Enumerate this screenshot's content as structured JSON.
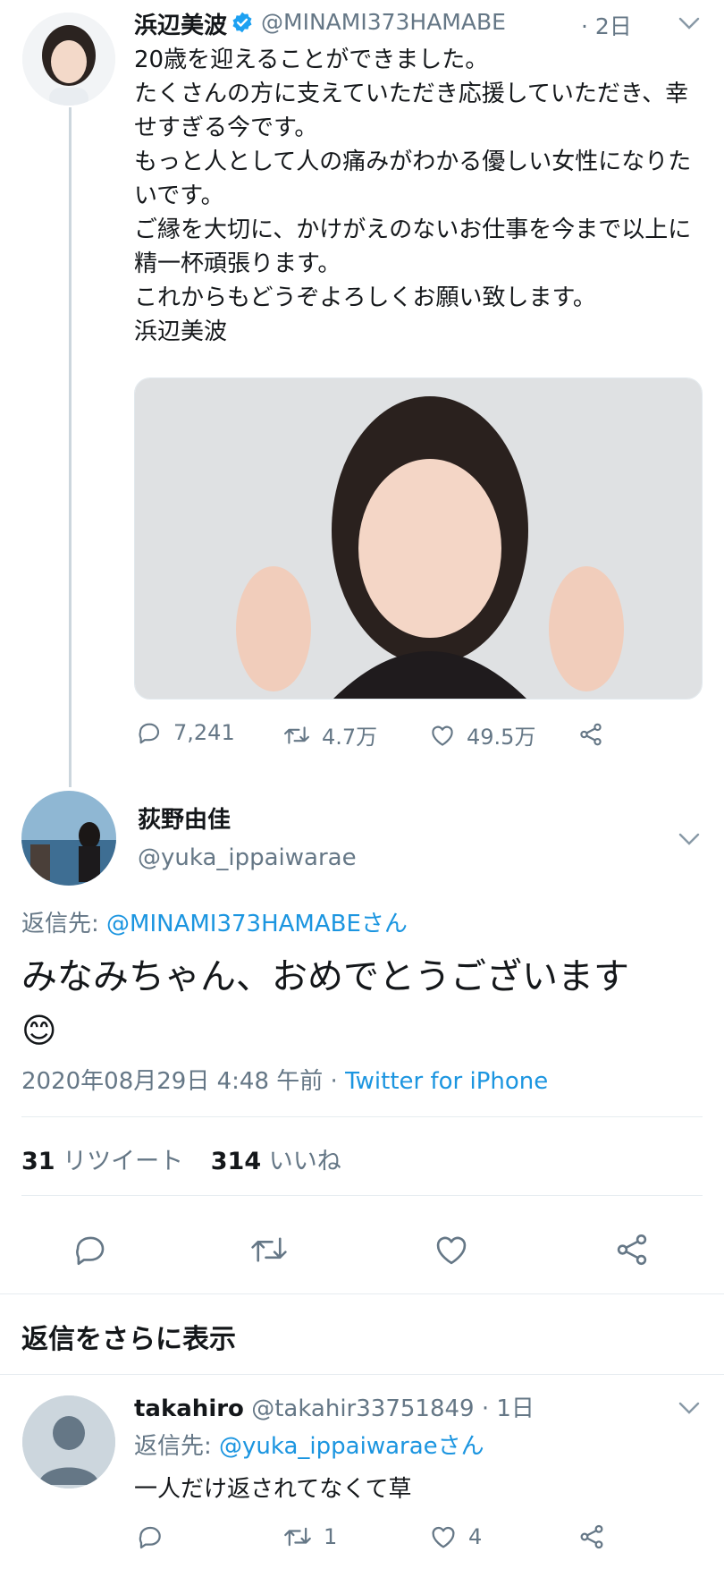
{
  "tweet1": {
    "display_name": "浜辺美波",
    "handle": "@MINAMI373HAMABE",
    "time": "· 2日",
    "text": "20歳を迎えることができました。\nたくさんの方に支えていただき応援していただき、幸せすぎる今です。\nもっと人として人の痛みがわかる優しい女性になりたいです。\nご縁を大切に、かけがえのないお仕事を今まで以上に精一杯頑張ります。\nこれからもどうぞよろしくお願い致します。\n浜辺美波",
    "replies": "7,241",
    "retweets": "4.7万",
    "likes": "49.5万"
  },
  "reply_main": {
    "display_name": "荻野由佳",
    "handle": "@yuka_ippaiwarae",
    "reply_to_label": "返信先:",
    "reply_to_handle": "@MINAMI373HAMABEさん",
    "text": "みなみちゃん、おめでとうございます",
    "emoji": "😊",
    "timestamp": "2020年08月29日 4:48 午前",
    "dot": "·",
    "source": "Twitter for iPhone",
    "retweet_count": "31",
    "retweet_label": "リツイート",
    "like_count": "314",
    "like_label": "いいね"
  },
  "more_replies": {
    "title": "返信をさらに表示"
  },
  "reply2": {
    "display_name": "takahiro",
    "handle": "@takahir33751849",
    "time": "· 1日",
    "reply_to_label": "返信先:",
    "reply_to_handle": "@yuka_ippaiwaraeさん",
    "text": "一人だけ返されてなくて草",
    "retweets": "1",
    "likes": "4"
  },
  "colors": {
    "accent": "#1b95e0",
    "muted": "#657786",
    "divider": "#e6ecf0",
    "verified": "#1da1f2"
  }
}
